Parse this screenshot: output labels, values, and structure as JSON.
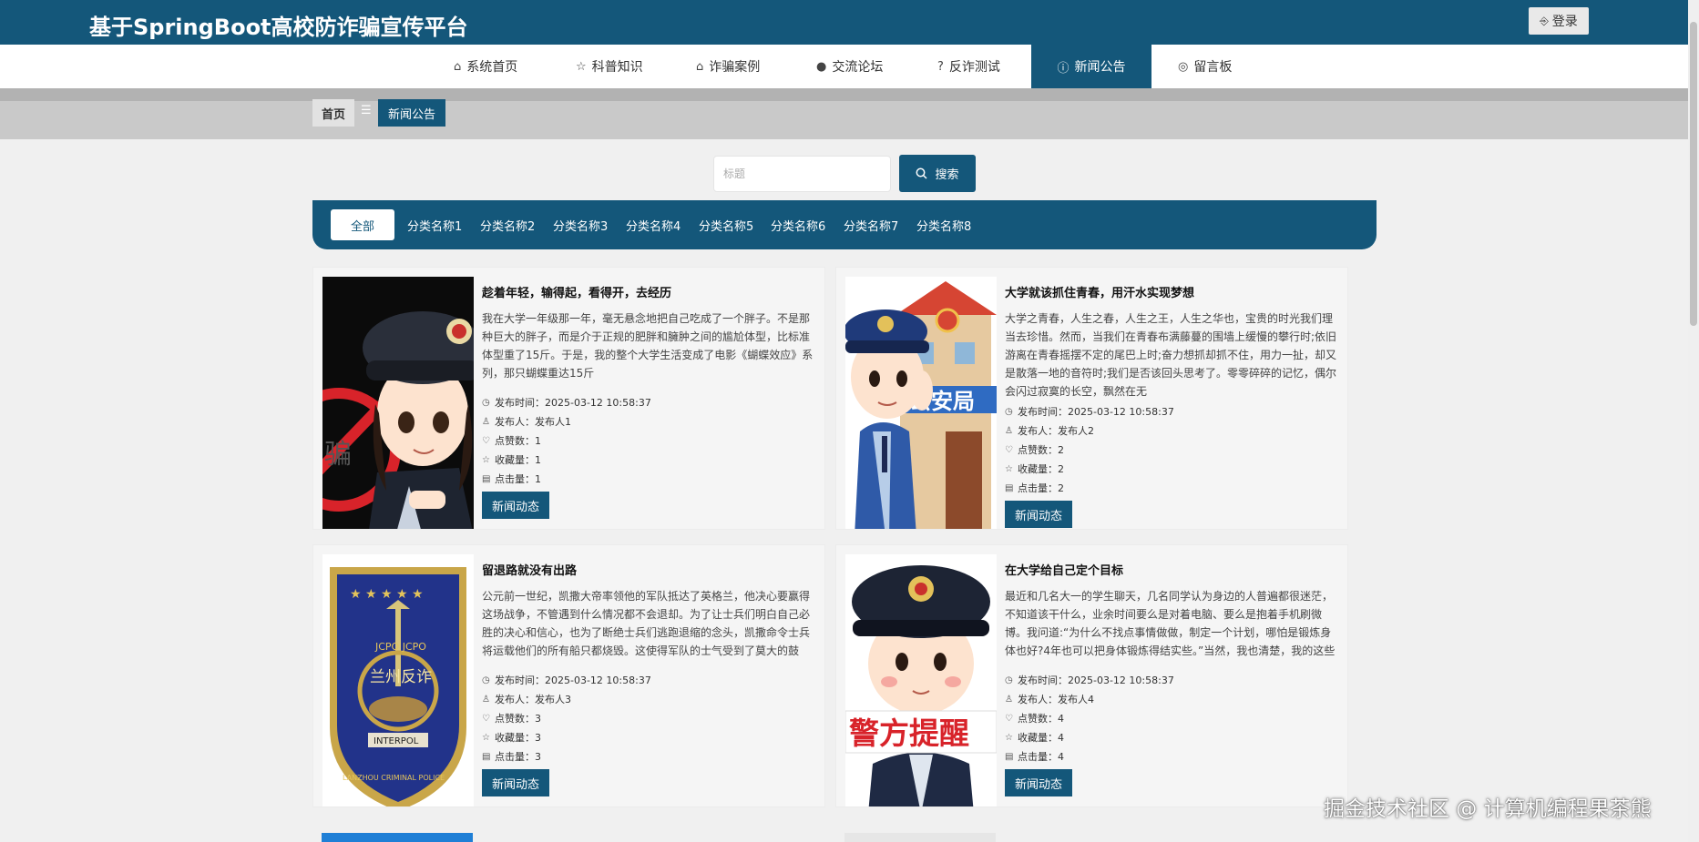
{
  "header": {
    "title": "基于SpringBoot高校防诈骗宣传平台",
    "login_label": "登录"
  },
  "nav": {
    "items": [
      {
        "label": "系统首页",
        "icon": "home-icon"
      },
      {
        "label": "科普知识",
        "icon": "star-icon"
      },
      {
        "label": "诈骗案例",
        "icon": "lock-icon"
      },
      {
        "label": "交流论坛",
        "icon": "alert-icon"
      },
      {
        "label": "反诈测试",
        "icon": "question-icon"
      },
      {
        "label": "新闻公告",
        "icon": "info-icon"
      },
      {
        "label": "留言板",
        "icon": "target-icon"
      }
    ],
    "active": "新闻公告"
  },
  "breadcrumb": {
    "home": "首页",
    "separator": "☰",
    "current": "新闻公告"
  },
  "search": {
    "placeholder": "标题",
    "value": "",
    "button_label": "搜索"
  },
  "categories": {
    "all": "全部",
    "items": [
      "分类名称1",
      "分类名称2",
      "分类名称3",
      "分类名称4",
      "分类名称5",
      "分类名称6",
      "分类名称7",
      "分类名称8"
    ]
  },
  "news": [
    {
      "title": "趁着年轻，输得起，看得开，去经历",
      "excerpt": "我在大学一年级那一年，毫无悬念地把自己吃成了一个胖子。不是那种巨大的胖子，而是介于正规的肥胖和臃肿之间的尴尬体型，比标准体型重了15斤。于是，我的整个大学生活变成了电影《蝴蝶效应》系列，那只蝴蝶重达15斤",
      "time_label": "发布时间：2025-03-12 10:58:37",
      "author_label": "发布人：发布人1",
      "likes_label": "点赞数：1",
      "favs_label": "收藏量：1",
      "clicks_label": "点击量：1",
      "tag": "新闻动态",
      "image": "police-anti-fraud-cartoon"
    },
    {
      "title": "大学就该抓住青春，用汗水实现梦想",
      "excerpt": "大学之青春，人生之春，人生之王，人生之华也，宝贵的时光我们理当去珍惜。然而，当我们在青春布满藤蔓的围墙上缓慢的攀行时;依旧游离在青春摇摆不定的尾巴上时;奋力想抓却抓不住，用力一扯，却又是散落一地的音符时;我们是否该回头思考了。零零碎碎的记忆，偶尔会闪过寂寞的长空，飘然在无",
      "time_label": "发布时间：2025-03-12 10:58:37",
      "author_label": "发布人：发布人2",
      "likes_label": "点赞数：2",
      "favs_label": "收藏量：2",
      "clicks_label": "点击量：2",
      "tag": "新闻动态",
      "image": "police-station-cartoon"
    },
    {
      "title": "留退路就没有出路",
      "excerpt": "公元前一世纪，凯撒大帝率领他的军队抵达了英格兰，他决心要赢得这场战争，不管遇到什么情况都不会退却。为了让士兵们明白自己必胜的决心和信心，也为了断绝士兵们逃跑退缩的念头，凯撒命令士兵将运载他们的所有船只都烧毁。这使得军队的士气受到了莫大的鼓舞。后来他们获胜了",
      "time_label": "发布时间：2025-03-12 10:58:37",
      "author_label": "发布人：发布人3",
      "likes_label": "点赞数：3",
      "favs_label": "收藏量：3",
      "clicks_label": "点击量：3",
      "tag": "新闻动态",
      "image": "police-badge",
      "badge_text": "兰州反诈",
      "badge_ribbon": "INTERPOL",
      "badge_bottom": "LANZHOU CRIMINAL POLICE",
      "badge_top": "JCPO JCPO"
    },
    {
      "title": "在大学给自己定个目标",
      "excerpt": "最近和几名大一的学生聊天，几名同学认为身边的人普遍都很迷茫，不知道该干什么，业余时间要么是对着电脑、要么是抱着手机刷微博。我问道:“为什么不找点事情做做，制定一个计划，哪怕是锻炼身体也好?4年也可以把身体锻炼得结实些。”当然，我也清楚，我的这些建议对他们来说，未必能有",
      "time_label": "发布时间：2025-03-12 10:58:37",
      "author_label": "发布人：发布人4",
      "likes_label": "点赞数：4",
      "favs_label": "收藏量：4",
      "clicks_label": "点击量：4",
      "tag": "新闻动态",
      "image": "police-reminder-cartoon",
      "sign_text": "警方提醒"
    }
  ],
  "image_text": {
    "card1_sign": "骗",
    "card2_sign": "公安局"
  },
  "watermark": "掘金技术社区 @ 计算机编程果茶熊",
  "colors": {
    "primary": "#14577a",
    "background": "#f0f0f0",
    "card": "#f5f5f5"
  }
}
